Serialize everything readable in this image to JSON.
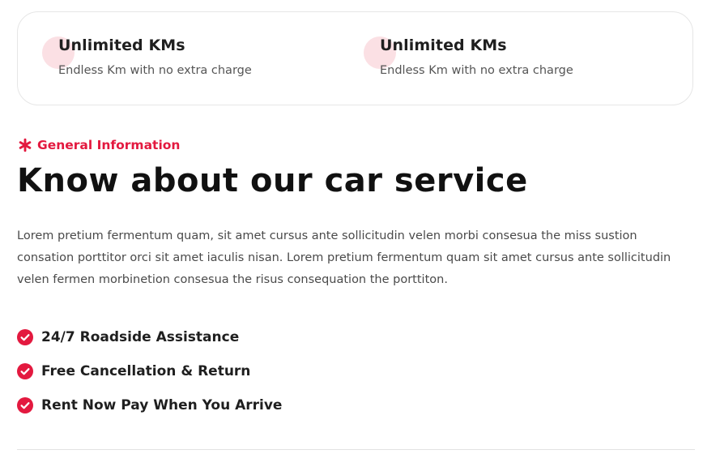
{
  "features": [
    {
      "title": "Unlimited KMs",
      "description": "Endless Km with no extra charge"
    },
    {
      "title": "Unlimited KMs",
      "description": "Endless Km with no extra charge"
    }
  ],
  "section": {
    "eyebrow": "General Information",
    "heading": "Know about our car service",
    "paragraph": "Lorem pretium fermentum quam, sit amet cursus ante sollicitudin velen morbi consesua the miss sustion consation porttitor orci sit amet iaculis nisan. Lorem pretium fermentum quam sit amet cursus ante sollicitudin velen fermen morbinetion consesua the risus consequation the porttiton."
  },
  "checklist": [
    "24/7 Roadside Assistance",
    "Free Cancellation & Return",
    "Rent Now Pay When You Arrive"
  ],
  "colors": {
    "accent": "#e3193f",
    "accent_soft": "#fbe0e4",
    "text_dark": "#111111",
    "text_muted": "#4a4a4a"
  },
  "icons": {
    "feature_icon": "feature-circle-icon",
    "eyebrow_icon": "asterisk-icon",
    "check_icon": "check-circle-icon"
  }
}
